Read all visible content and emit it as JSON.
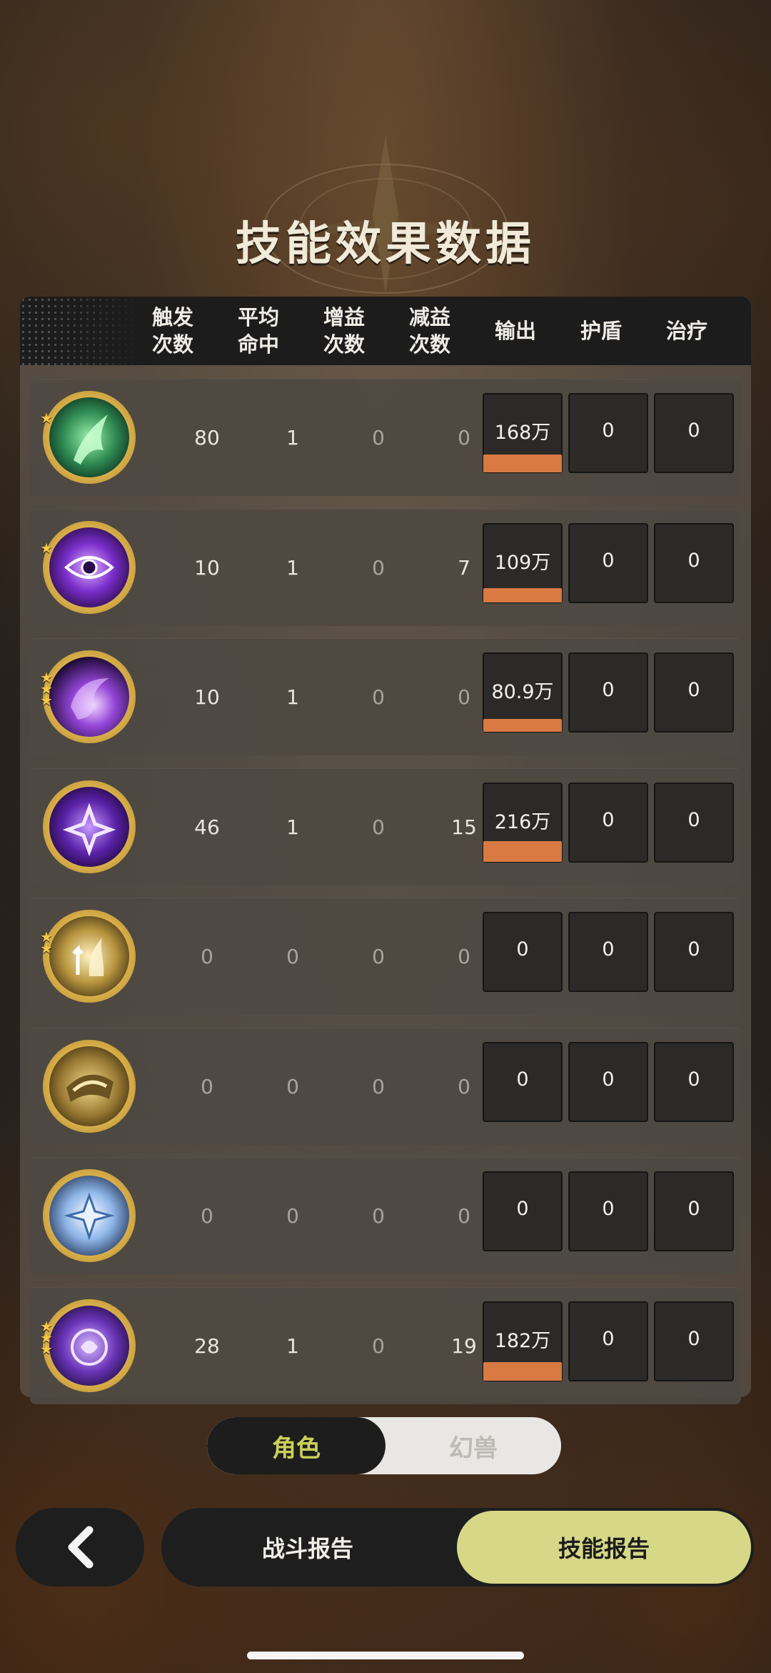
{
  "title": "技能效果数据",
  "columns": [
    {
      "line1": "触发",
      "line2": "次数"
    },
    {
      "line1": "平均",
      "line2": "命中"
    },
    {
      "line1": "增益",
      "line2": "次数"
    },
    {
      "line1": "减益",
      "line2": "次数"
    },
    {
      "line1": "输出",
      "line2": ""
    },
    {
      "line1": "护盾",
      "line2": ""
    },
    {
      "line1": "治疗",
      "line2": ""
    }
  ],
  "rows": [
    {
      "icon": "green-flame-skill-icon",
      "stars": 1,
      "trigger": "80",
      "avg_hit": "1",
      "buff": "0",
      "debuff": "0",
      "damage": "168万",
      "damage_share": 0.5,
      "shield": "0",
      "heal": "0"
    },
    {
      "icon": "purple-eye-vortex-skill-icon",
      "stars": 1,
      "trigger": "10",
      "avg_hit": "1",
      "buff": "0",
      "debuff": "7",
      "damage": "109万",
      "damage_share": 0.33,
      "shield": "0",
      "heal": "0"
    },
    {
      "icon": "purple-swirl-orb-skill-icon",
      "stars": 3,
      "trigger": "10",
      "avg_hit": "1",
      "buff": "0",
      "debuff": "0",
      "damage": "80.9万",
      "damage_share": 0.25,
      "shield": "0",
      "heal": "0"
    },
    {
      "icon": "purple-star-sigil-skill-icon",
      "stars": 0,
      "trigger": "46",
      "avg_hit": "1",
      "buff": "0",
      "debuff": "15",
      "damage": "216万",
      "damage_share": 0.64,
      "shield": "0",
      "heal": "0"
    },
    {
      "icon": "golden-arrow-flame-skill-icon",
      "stars": 2,
      "trigger": "0",
      "avg_hit": "0",
      "buff": "0",
      "debuff": "0",
      "damage": "0",
      "damage_share": 0,
      "shield": "0",
      "heal": "0"
    },
    {
      "icon": "golden-armor-skill-icon",
      "stars": 0,
      "trigger": "0",
      "avg_hit": "0",
      "buff": "0",
      "debuff": "0",
      "damage": "0",
      "damage_share": 0,
      "shield": "0",
      "heal": "0"
    },
    {
      "icon": "blue-crystal-star-skill-icon",
      "stars": 0,
      "trigger": "0",
      "avg_hit": "0",
      "buff": "0",
      "debuff": "0",
      "damage": "0",
      "damage_share": 0,
      "shield": "0",
      "heal": "0"
    },
    {
      "icon": "purple-orb-sigil-skill-icon",
      "stars": 3,
      "trigger": "28",
      "avg_hit": "1",
      "buff": "0",
      "debuff": "19",
      "damage": "182万",
      "damage_share": 0.54,
      "shield": "0",
      "heal": "0"
    }
  ],
  "toggle": {
    "active": "角色",
    "inactive": "幻兽"
  },
  "nav": {
    "back": "back-arrow-icon",
    "battle_report": "战斗报告",
    "skill_report": "技能报告"
  },
  "colors": {
    "accent_bar": "#d97a43",
    "toggle_active_text": "#c9d05a",
    "nav_active_bg": "#d7d788",
    "ring_gold": "#d9b04a"
  }
}
